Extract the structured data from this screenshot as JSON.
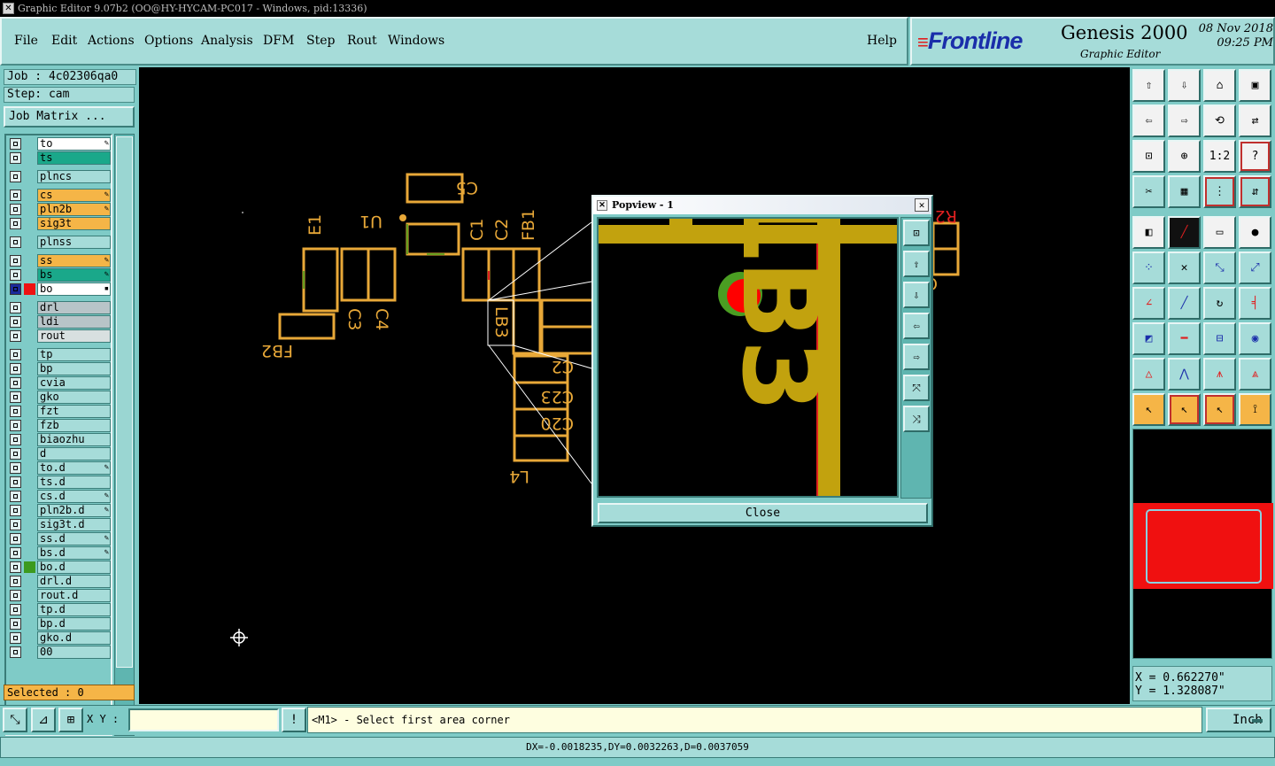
{
  "window": {
    "title": "Graphic Editor 9.07b2 (OO@HY-HYCAM-PC017 - Windows, pid:13336)"
  },
  "menu": {
    "file": "File",
    "edit": "Edit",
    "actions": "Actions",
    "options": "Options",
    "analysis": "Analysis",
    "dfm": "DFM",
    "step": "Step",
    "rout": "Rout",
    "windows": "Windows",
    "help": "Help"
  },
  "brand": {
    "logo": "Frontline",
    "product": "Genesis 2000",
    "subtitle": "Graphic Editor",
    "date": "08 Nov 2018",
    "time": "09:25 PM"
  },
  "job": {
    "job_label": "Job : 4c02306qa0",
    "step_label": "Step: cam",
    "matrix_button": "Job Matrix ...",
    "selected": "Selected : 0"
  },
  "layers": [
    {
      "name": "to",
      "color": "#ffffff",
      "flag": "✎"
    },
    {
      "name": "ts",
      "color": "#1aa88a",
      "flag": ""
    },
    {
      "name": "plncs",
      "color": "#a6dcd9",
      "flag": ""
    },
    {
      "name": "cs",
      "color": "#f5b547",
      "flag": "✎"
    },
    {
      "name": "pln2b",
      "color": "#f5b547",
      "flag": "✎"
    },
    {
      "name": "sig3t",
      "color": "#f5b547",
      "flag": ""
    },
    {
      "name": "plnss",
      "color": "#a6dcd9",
      "flag": ""
    },
    {
      "name": "ss",
      "color": "#f5b547",
      "flag": "✎"
    },
    {
      "name": "bs",
      "color": "#1aa88a",
      "flag": "✎"
    },
    {
      "name": "bo",
      "color": "#ffffff",
      "flag": "▪"
    },
    {
      "name": "drl",
      "color": "#b8c4c8",
      "flag": ""
    },
    {
      "name": "ldi",
      "color": "#b8c4c8",
      "flag": ""
    },
    {
      "name": "rout",
      "color": "#d8e0e0",
      "flag": ""
    },
    {
      "name": "tp",
      "color": "#a6dcd9",
      "flag": ""
    },
    {
      "name": "bp",
      "color": "#a6dcd9",
      "flag": ""
    },
    {
      "name": "cvia",
      "color": "#a6dcd9",
      "flag": ""
    },
    {
      "name": "gko",
      "color": "#a6dcd9",
      "flag": ""
    },
    {
      "name": "fzt",
      "color": "#a6dcd9",
      "flag": ""
    },
    {
      "name": "fzb",
      "color": "#a6dcd9",
      "flag": ""
    },
    {
      "name": "biaozhu",
      "color": "#a6dcd9",
      "flag": ""
    },
    {
      "name": "d",
      "color": "#a6dcd9",
      "flag": ""
    },
    {
      "name": "to.d",
      "color": "#a6dcd9",
      "flag": "✎"
    },
    {
      "name": "ts.d",
      "color": "#a6dcd9",
      "flag": ""
    },
    {
      "name": "cs.d",
      "color": "#a6dcd9",
      "flag": "✎"
    },
    {
      "name": "pln2b.d",
      "color": "#a6dcd9",
      "flag": "✎"
    },
    {
      "name": "sig3t.d",
      "color": "#a6dcd9",
      "flag": ""
    },
    {
      "name": "ss.d",
      "color": "#a6dcd9",
      "flag": "✎"
    },
    {
      "name": "bs.d",
      "color": "#a6dcd9",
      "flag": "✎"
    },
    {
      "name": "bo.d",
      "color": "#a6dcd9",
      "flag": ""
    },
    {
      "name": "drl.d",
      "color": "#a6dcd9",
      "flag": ""
    },
    {
      "name": "rout.d",
      "color": "#a6dcd9",
      "flag": ""
    },
    {
      "name": "tp.d",
      "color": "#a6dcd9",
      "flag": ""
    },
    {
      "name": "bp.d",
      "color": "#a6dcd9",
      "flag": ""
    },
    {
      "name": "gko.d",
      "color": "#a6dcd9",
      "flag": ""
    },
    {
      "name": "00",
      "color": "#a6dcd9",
      "flag": ""
    }
  ],
  "canvas_labels": {
    "c5": "C5",
    "u1": "U1",
    "e1": "E1",
    "c1": "C1",
    "c2": "C2",
    "fb1": "FB1",
    "c3": "C3",
    "c4": "C4",
    "fb2": "FB2",
    "lb3": "LB3",
    "l4": "L4",
    "c23": "C23",
    "c20": "C20",
    "c2r": "C2",
    "r2": "R2",
    "c": "C"
  },
  "popview": {
    "title": "Popview - 1",
    "label": "LB3",
    "close": "Close"
  },
  "tools": {
    "scale": "1:2",
    "help": "?"
  },
  "coords": {
    "x": "X = 0.662270\"",
    "y": "Y = 1.328087\""
  },
  "bottom": {
    "xy_label": "X Y :",
    "xy_value": "",
    "prompt": "<M1> - Select first area corner",
    "unit": "Inch"
  },
  "status": {
    "text": "DX=-0.0018235,DY=0.0032263,D=0.0037059"
  },
  "colors": {
    "trace": "#d4a017",
    "outline": "#e8a838",
    "highlight": "#e02020"
  }
}
